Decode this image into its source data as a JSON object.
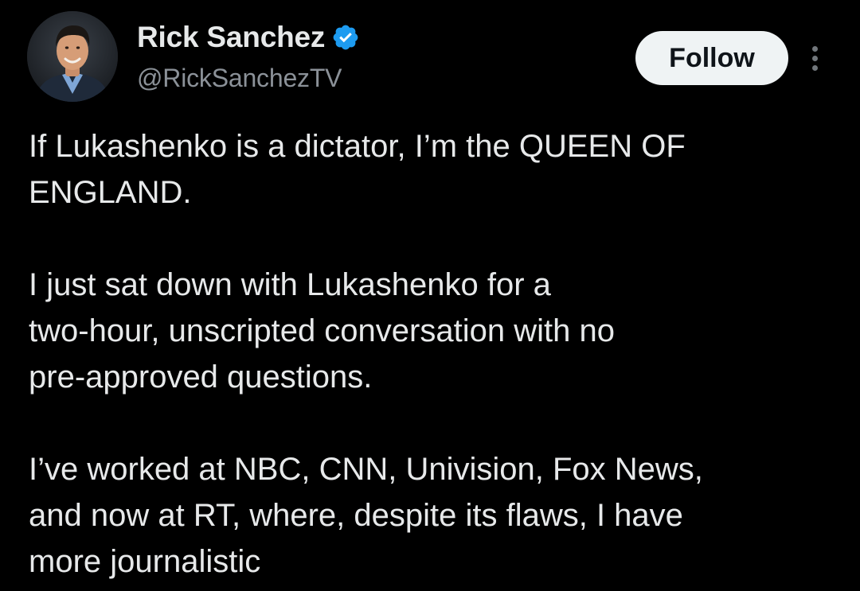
{
  "tweet": {
    "author": {
      "display_name": "Rick Sanchez",
      "handle": "@RickSanchezTV",
      "verified_icon": "verified-badge-icon",
      "avatar_icon": "profile-photo"
    },
    "follow_label": "Follow",
    "more_icon": "more-options-icon",
    "paragraphs": [
      "If Lukashenko is a dictator, I’m the QUEEN OF\nENGLAND.",
      "I just sat down with Lukashenko for a\ntwo-hour, unscripted conversation with no\npre-approved questions.",
      "I’ve worked at NBC, CNN, Univision, Fox News,\nand now at RT, where, despite its flaws, I have\nmore journalistic"
    ]
  },
  "colors": {
    "background": "#000000",
    "text_primary": "#e7e9ea",
    "text_secondary": "#8b9198",
    "verified_blue": "#1d9bf0",
    "follow_bg": "#eff3f4",
    "follow_text": "#0f1419"
  }
}
